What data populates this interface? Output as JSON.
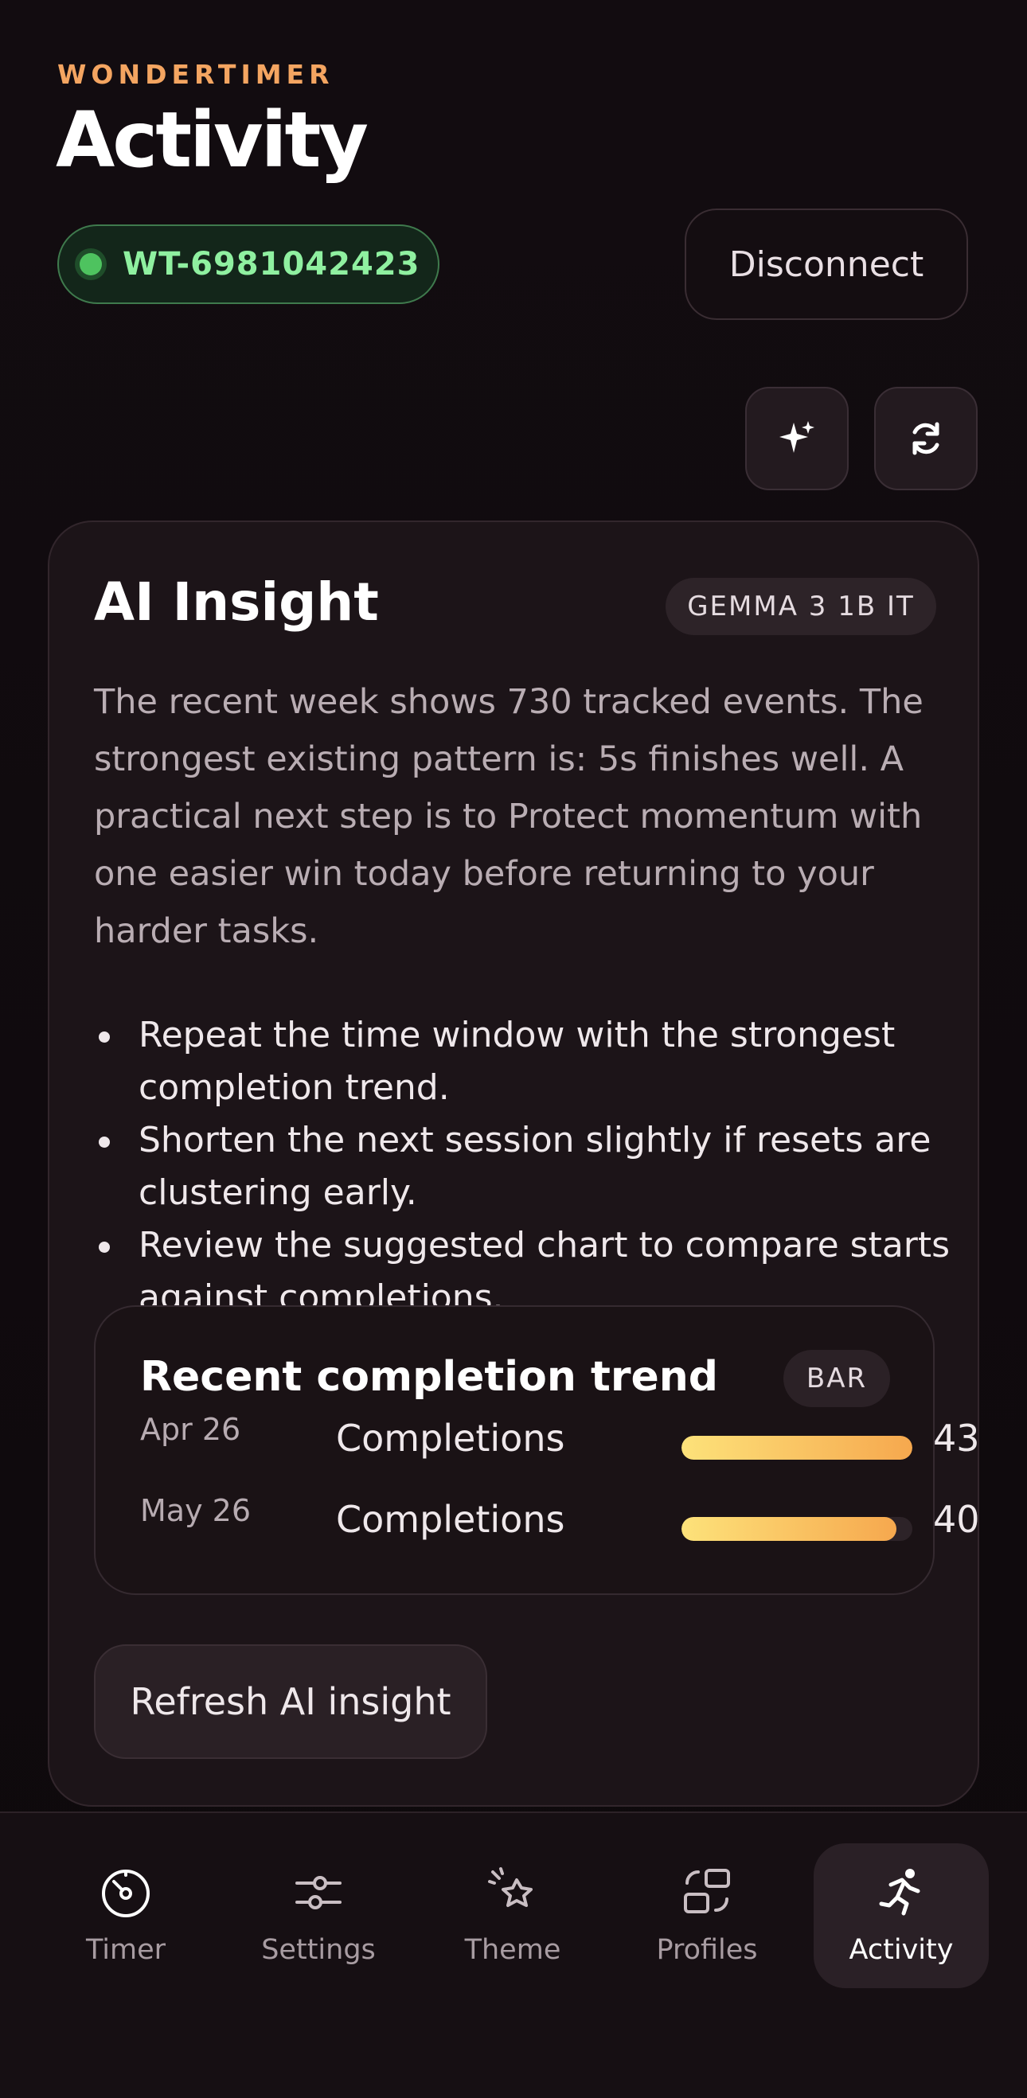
{
  "app": {
    "brand": "WONDERTIMER",
    "title": "Activity"
  },
  "device": {
    "id": "WT-6981042423",
    "status_color": "#4ec35f"
  },
  "header": {
    "disconnect_label": "Disconnect"
  },
  "icons": {
    "suggest": "sparkle-icon",
    "refresh": "refresh-icon"
  },
  "insight": {
    "title": "AI Insight",
    "model": "GEMMA 3 1B IT",
    "summary": "The recent week shows 730 tracked events. The strongest existing pattern is: 5s finishes well. A practical next step is to Protect momentum with one easier win today before returning to your harder tasks.",
    "tips": [
      "Repeat the time window with the strongest completion trend.",
      "Shorten the next session slightly if resets are clustering early.",
      "Review the suggested chart to compare starts against completions."
    ],
    "refresh_label": "Refresh AI insight"
  },
  "chart_data": {
    "type": "bar",
    "title": "Recent completion trend",
    "type_label": "BAR",
    "categories": [
      "Apr 26",
      "May 26"
    ],
    "series": [
      {
        "name": "Completions",
        "values": [
          43,
          40
        ]
      }
    ],
    "max": 43,
    "colors": [
      "#fde27a",
      "#f6a84e"
    ]
  },
  "nav": {
    "items": [
      {
        "label": "Timer",
        "icon": "timer-icon"
      },
      {
        "label": "Settings",
        "icon": "sliders-icon"
      },
      {
        "label": "Theme",
        "icon": "theme-icon"
      },
      {
        "label": "Profiles",
        "icon": "profiles-icon"
      },
      {
        "label": "Activity",
        "icon": "activity-icon"
      }
    ],
    "active": "Activity"
  },
  "colors": {
    "accent": "#f4a561",
    "background": "#0f0a0d",
    "card": "#1c1418",
    "success": "#8ff0a0"
  }
}
